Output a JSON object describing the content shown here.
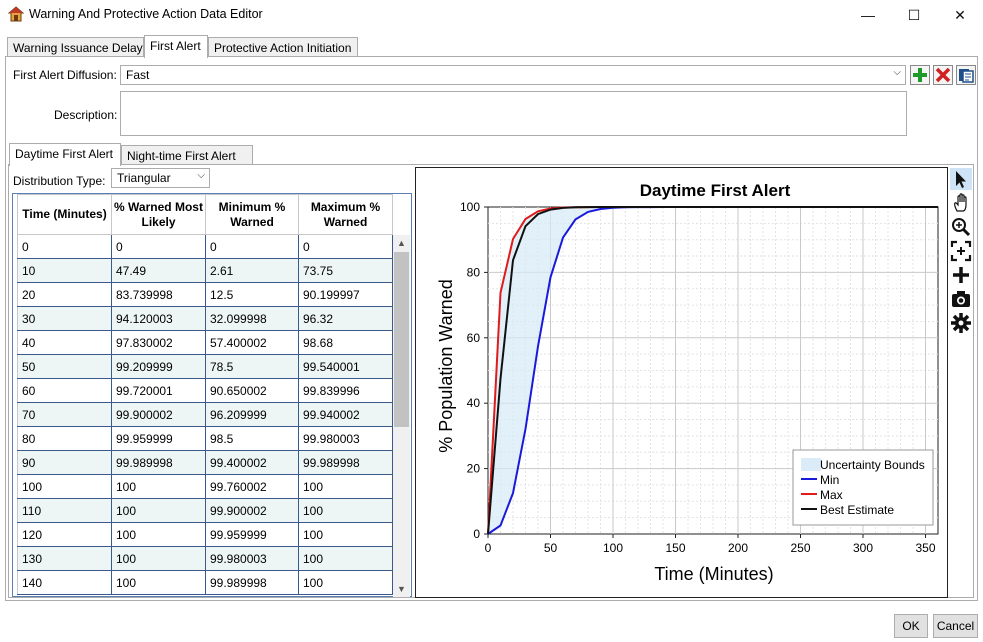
{
  "window": {
    "title": "Warning And Protective Action Data Editor",
    "minimize_glyph": "—",
    "maximize_glyph": "☐",
    "close_glyph": "✕"
  },
  "tabs": [
    {
      "label": "Warning Issuance Delay"
    },
    {
      "label": "First Alert"
    },
    {
      "label": "Protective Action Initiation"
    }
  ],
  "form": {
    "diffusion_label": "First Alert Diffusion:",
    "diffusion_value": "Fast",
    "description_label": "Description:",
    "description_value": ""
  },
  "subtabs": [
    {
      "label": "Daytime First Alert"
    },
    {
      "label": "Night-time First Alert"
    }
  ],
  "distribution": {
    "label": "Distribution Type:",
    "value": "Triangular"
  },
  "table": {
    "headers": [
      "Time (Minutes)",
      "% Warned Most Likely",
      "Minimum % Warned",
      "Maximum % Warned"
    ],
    "rows": [
      [
        "0",
        "0",
        "0",
        "0"
      ],
      [
        "10",
        "47.49",
        "2.61",
        "73.75"
      ],
      [
        "20",
        "83.739998",
        "12.5",
        "90.199997"
      ],
      [
        "30",
        "94.120003",
        "32.099998",
        "96.32"
      ],
      [
        "40",
        "97.830002",
        "57.400002",
        "98.68"
      ],
      [
        "50",
        "99.209999",
        "78.5",
        "99.540001"
      ],
      [
        "60",
        "99.720001",
        "90.650002",
        "99.839996"
      ],
      [
        "70",
        "99.900002",
        "96.209999",
        "99.940002"
      ],
      [
        "80",
        "99.959999",
        "98.5",
        "99.980003"
      ],
      [
        "90",
        "99.989998",
        "99.400002",
        "99.989998"
      ],
      [
        "100",
        "100",
        "99.760002",
        "100"
      ],
      [
        "110",
        "100",
        "99.900002",
        "100"
      ],
      [
        "120",
        "100",
        "99.959999",
        "100"
      ],
      [
        "130",
        "100",
        "99.980003",
        "100"
      ],
      [
        "140",
        "100",
        "99.989998",
        "100"
      ]
    ]
  },
  "chart_data": {
    "type": "line",
    "title": "Daytime First Alert",
    "xlabel": "Time (Minutes)",
    "ylabel": "% Population Warned",
    "xlim": [
      0,
      360
    ],
    "ylim": [
      0,
      100
    ],
    "xticks": [
      0,
      50,
      100,
      150,
      200,
      250,
      300,
      350
    ],
    "yticks": [
      0,
      20,
      40,
      60,
      80,
      100
    ],
    "grid": true,
    "legend_position": "bottom-right",
    "x": [
      0,
      10,
      20,
      30,
      40,
      50,
      60,
      70,
      80,
      90,
      100,
      110,
      120,
      130,
      140,
      150,
      360
    ],
    "series": [
      {
        "name": "Min",
        "color": "#1a1adc",
        "values": [
          0,
          2.61,
          12.5,
          32.1,
          57.4,
          78.5,
          90.65,
          96.21,
          98.5,
          99.4,
          99.76,
          99.9,
          99.96,
          99.98,
          99.99,
          100,
          100
        ]
      },
      {
        "name": "Max",
        "color": "#e01b1b",
        "values": [
          0,
          73.75,
          90.2,
          96.32,
          98.68,
          99.54,
          99.84,
          99.94,
          99.98,
          99.99,
          100,
          100,
          100,
          100,
          100,
          100,
          100
        ]
      },
      {
        "name": "Best Estimate",
        "color": "#111111",
        "values": [
          0,
          47.49,
          83.74,
          94.12,
          97.83,
          99.21,
          99.72,
          99.9,
          99.96,
          99.99,
          100,
          100,
          100,
          100,
          100,
          100,
          100
        ]
      }
    ],
    "band": {
      "name": "Uncertainty Bounds",
      "color": "#d6eaf8"
    }
  },
  "chart_toolbar": [
    "pointer-icon",
    "pan-hand-icon",
    "zoom-icon",
    "zoom-extents-icon",
    "add-point-icon",
    "camera-icon",
    "settings-gear-icon"
  ],
  "buttons": {
    "ok": "OK",
    "cancel": "Cancel"
  }
}
